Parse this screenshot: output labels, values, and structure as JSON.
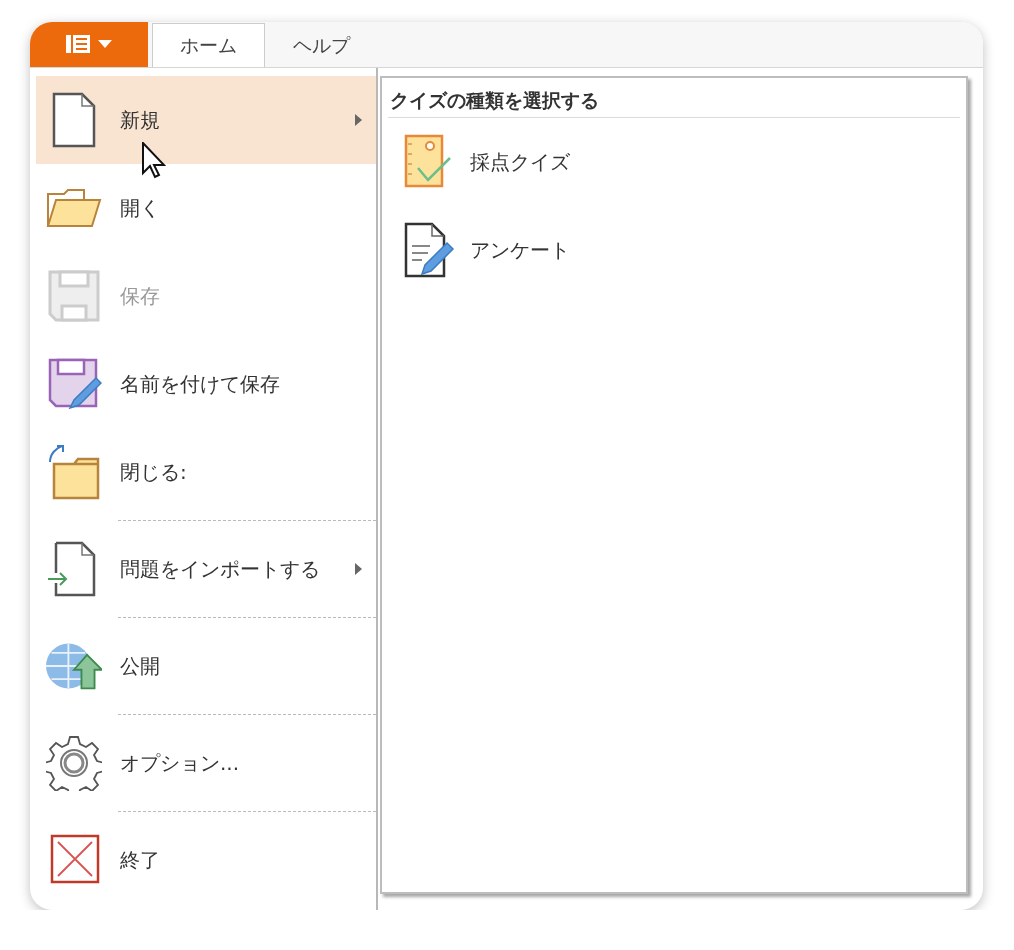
{
  "tabs": [
    {
      "label": "ホーム",
      "selected": true
    },
    {
      "label": "ヘルプ",
      "selected": false
    }
  ],
  "menu": [
    {
      "kind": "new",
      "label": "新規",
      "selected": true,
      "disabled": false,
      "submenu": true,
      "separator_above": false
    },
    {
      "kind": "open",
      "label": "開く",
      "selected": false,
      "disabled": false,
      "submenu": false,
      "separator_above": false
    },
    {
      "kind": "save",
      "label": "保存",
      "selected": false,
      "disabled": true,
      "submenu": false,
      "separator_above": false
    },
    {
      "kind": "saveas",
      "label": "名前を付けて保存",
      "selected": false,
      "disabled": false,
      "submenu": false,
      "separator_above": false
    },
    {
      "kind": "close",
      "label": "閉じる:",
      "selected": false,
      "disabled": false,
      "submenu": false,
      "separator_above": false
    },
    {
      "kind": "import",
      "label": "問題をインポートする",
      "selected": false,
      "disabled": false,
      "submenu": true,
      "separator_above": true
    },
    {
      "kind": "publish",
      "label": "公開",
      "selected": false,
      "disabled": false,
      "submenu": false,
      "separator_above": true
    },
    {
      "kind": "options",
      "label": "オプション...",
      "selected": false,
      "disabled": false,
      "submenu": false,
      "separator_above": true
    },
    {
      "kind": "exit",
      "label": "終了",
      "selected": false,
      "disabled": false,
      "submenu": false,
      "separator_above": true
    }
  ],
  "submenu": {
    "title": "クイズの種類を選択する",
    "items": [
      {
        "kind": "graded",
        "label": "採点クイズ"
      },
      {
        "kind": "survey",
        "label": "アンケート"
      }
    ]
  }
}
